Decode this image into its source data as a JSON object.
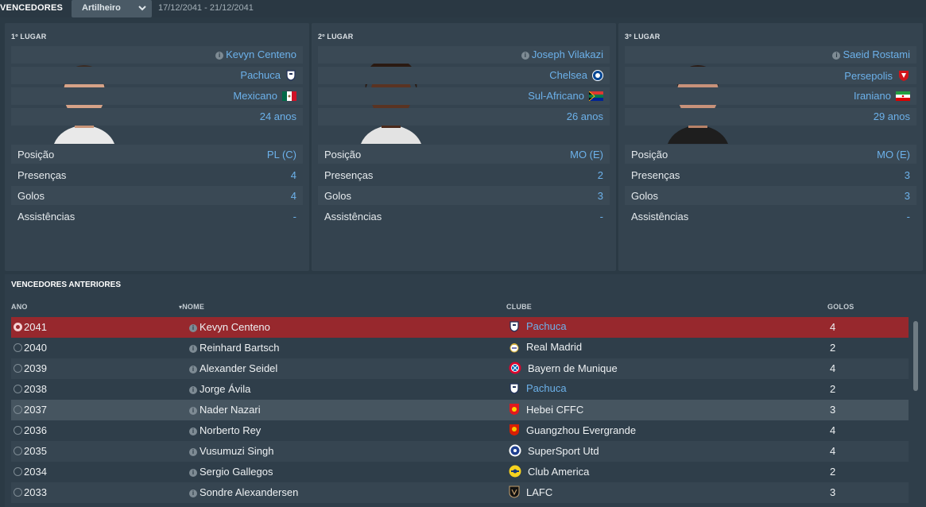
{
  "header": {
    "title": "VENCEDORES",
    "dropdown_value": "Artilheiro",
    "date_range": "17/12/2041 - 21/12/2041"
  },
  "podium": [
    {
      "place": "1º LUGAR",
      "player": "Kevyn Centeno",
      "club": "Pachuca",
      "nationality": "Mexicano",
      "age": "24 anos",
      "stats": [
        {
          "label": "Posição",
          "value": "PL (C)"
        },
        {
          "label": "Presenças",
          "value": "4"
        },
        {
          "label": "Golos",
          "value": "4"
        },
        {
          "label": "Assistências",
          "value": "-"
        }
      ]
    },
    {
      "place": "2º LUGAR",
      "player": "Joseph Vilakazi",
      "club": "Chelsea",
      "nationality": "Sul-Africano",
      "age": "26 anos",
      "stats": [
        {
          "label": "Posição",
          "value": "MO (E)"
        },
        {
          "label": "Presenças",
          "value": "2"
        },
        {
          "label": "Golos",
          "value": "3"
        },
        {
          "label": "Assistências",
          "value": "-"
        }
      ]
    },
    {
      "place": "3º LUGAR",
      "player": "Saeid Rostami",
      "club": "Persepolis",
      "nationality": "Iraniano",
      "age": "29 anos",
      "stats": [
        {
          "label": "Posição",
          "value": "MO (E)"
        },
        {
          "label": "Presenças",
          "value": "3"
        },
        {
          "label": "Golos",
          "value": "3"
        },
        {
          "label": "Assistências",
          "value": "-"
        }
      ]
    }
  ],
  "previous": {
    "title": "VENCEDORES ANTERIORES",
    "columns": {
      "year": "ANO",
      "name": "NOME",
      "club": "CLUBE",
      "goals": "GOLOS"
    },
    "rows": [
      {
        "year": "2041",
        "name": "Kevyn Centeno",
        "club": "Pachuca",
        "goals": "4"
      },
      {
        "year": "2040",
        "name": "Reinhard Bartsch",
        "club": "Real Madrid",
        "goals": "2"
      },
      {
        "year": "2039",
        "name": "Alexander Seidel",
        "club": "Bayern de Munique",
        "goals": "4"
      },
      {
        "year": "2038",
        "name": "Jorge Ávila",
        "club": "Pachuca",
        "goals": "2"
      },
      {
        "year": "2037",
        "name": "Nader Nazari",
        "club": "Hebei CFFC",
        "goals": "3"
      },
      {
        "year": "2036",
        "name": "Norberto Rey",
        "club": "Guangzhou Evergrande",
        "goals": "4"
      },
      {
        "year": "2035",
        "name": "Vusumuzi Singh",
        "club": "SuperSport Utd",
        "goals": "4"
      },
      {
        "year": "2034",
        "name": "Sergio Gallegos",
        "club": "Club America",
        "goals": "2"
      },
      {
        "year": "2033",
        "name": "Sondre Alexandersen",
        "club": "LAFC",
        "goals": "3"
      }
    ]
  },
  "colors": {
    "accent_link": "#6cb1ea",
    "selected_row": "#97282d",
    "background": "#2b3a45"
  }
}
